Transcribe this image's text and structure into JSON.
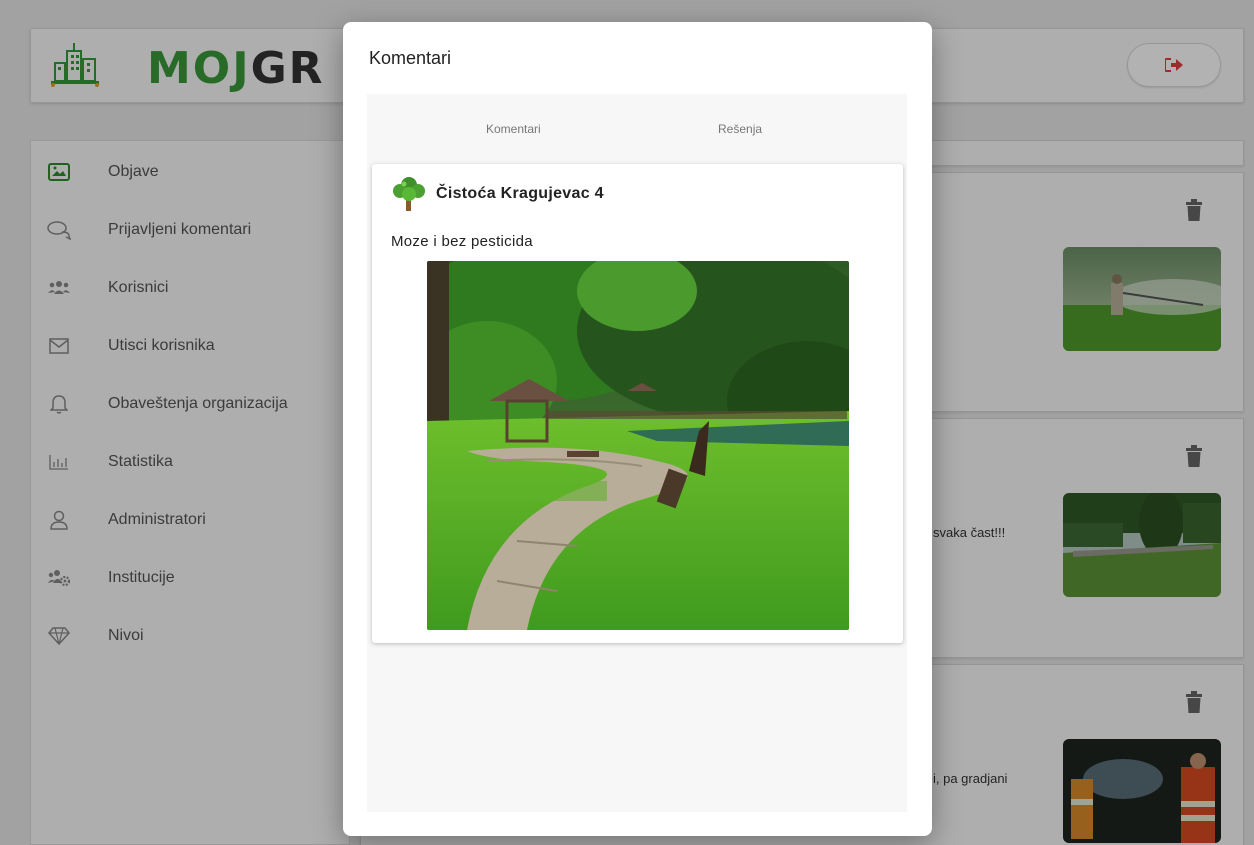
{
  "header": {
    "logo_part1": "MOJ",
    "logo_part2": "GR",
    "logout_icon": "sign-out-icon"
  },
  "sidebar": {
    "items": [
      {
        "label": "Objave",
        "icon": "image-icon"
      },
      {
        "label": "Prijavljeni komentari",
        "icon": "comments-icon"
      },
      {
        "label": "Korisnici",
        "icon": "users-icon"
      },
      {
        "label": "Utisci korisnika",
        "icon": "envelope-icon"
      },
      {
        "label": "Obaveštenja organizacija",
        "icon": "bell-icon"
      },
      {
        "label": "Statistika",
        "icon": "bar-chart-icon"
      },
      {
        "label": "Administratori",
        "icon": "user-icon"
      },
      {
        "label": "Institucije",
        "icon": "users-cog-icon"
      },
      {
        "label": "Nivoi",
        "icon": "gem-icon"
      }
    ]
  },
  "posts": [
    {
      "snippet": ""
    },
    {
      "snippet": "svaka čast!!!"
    },
    {
      "snippet": "i, pa gradjani"
    }
  ],
  "modal": {
    "title": "Komentari",
    "tabs": [
      "Komentari",
      "Rešenja"
    ],
    "comment": {
      "author": "Čistoća Kragujevac 4",
      "text": "Moze i bez pesticida",
      "avatar_icon": "tree-icon"
    }
  },
  "colors": {
    "brand_green": "#3a9a3a",
    "overlay": "rgba(0,0,0,0.30)"
  }
}
